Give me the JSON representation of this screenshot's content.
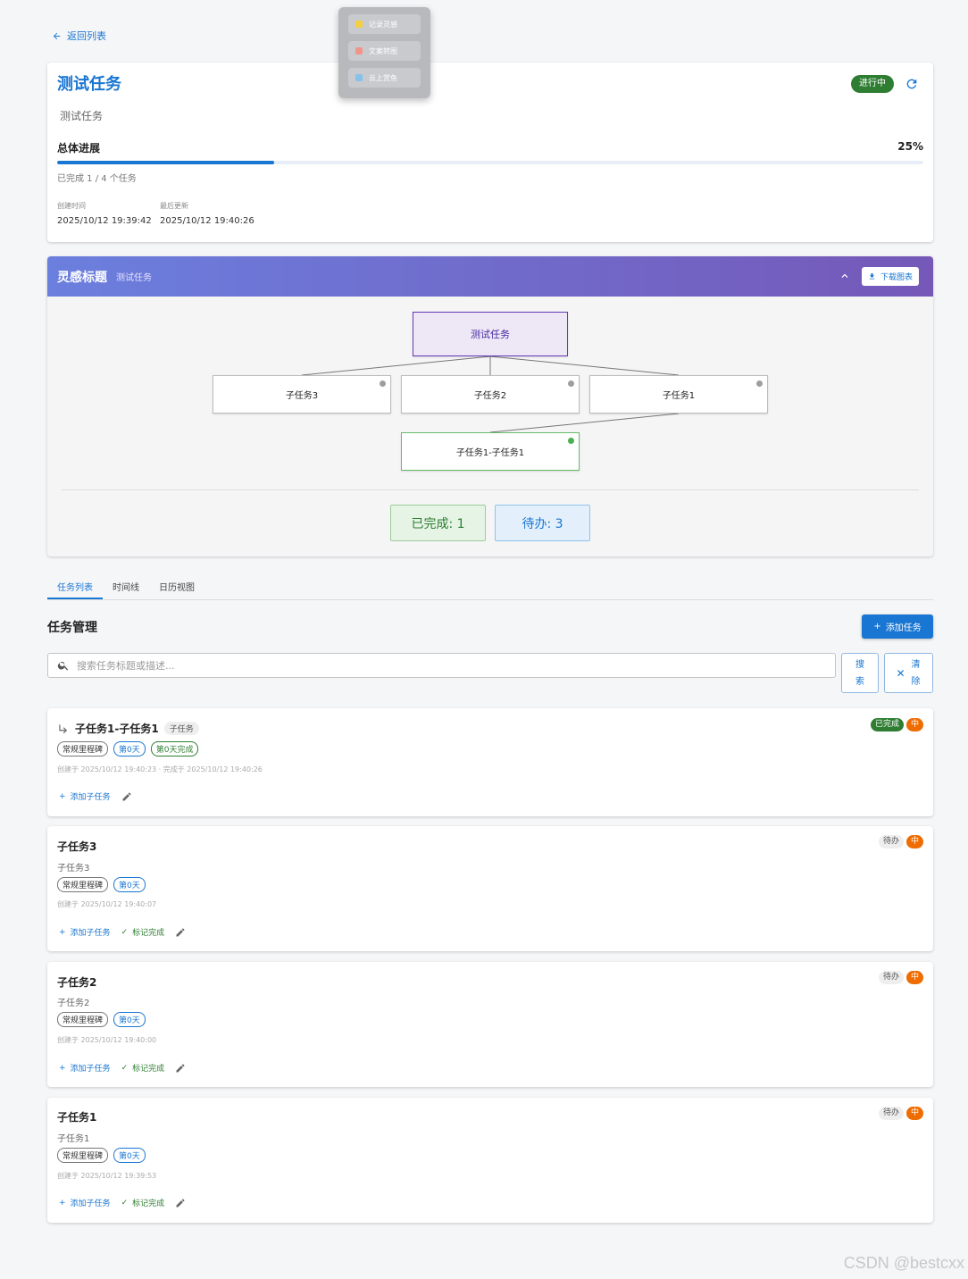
{
  "nav": {
    "back_label": "返回列表"
  },
  "quick_menu": {
    "items": [
      {
        "label": "记录灵感",
        "color": "#f4d03f"
      },
      {
        "label": "文案转图",
        "color": "#f1948a"
      },
      {
        "label": "云上赏鱼",
        "color": "#85c1e9"
      }
    ]
  },
  "task": {
    "title": "测试任务",
    "description": "测试任务",
    "status": "进行中",
    "progress_label": "总体进展",
    "progress_percent": "25%",
    "progress_value": 0.25,
    "progress_sub": "已完成 1 / 4 个任务",
    "created_label": "创建时间",
    "created_value": "2025/10/12 19:39:42",
    "updated_label": "最后更新",
    "updated_value": "2025/10/12 19:40:26"
  },
  "inspiration": {
    "title": "灵感标题",
    "subtitle": "测试任务",
    "download_label": "下载图表",
    "root": "测试任务",
    "nodes": [
      "子任务3",
      "子任务2",
      "子任务1"
    ],
    "child_node": "子任务1-子任务1",
    "stat_done": "已完成: 1",
    "stat_todo": "待办: 3"
  },
  "tabs": [
    "任务列表",
    "时间线",
    "日历视图"
  ],
  "manage": {
    "title": "任务管理",
    "add_label": "添加任务",
    "search_placeholder": "搜索任务标题或描述...",
    "search_label": "搜索",
    "clear_label": "清除"
  },
  "items": [
    {
      "title": "子任务1-子任务1",
      "sub_tag": "子任务",
      "tags": [
        "常规里程碑",
        "第0天",
        "第0天完成"
      ],
      "meta": "创建于 2025/10/12 19:40:23 · 完成于 2025/10/12 19:40:26",
      "status": "已完成",
      "priority": "中",
      "add_sub": "添加子任务"
    },
    {
      "title": "子任务3",
      "description": "子任务3",
      "tags": [
        "常规里程碑",
        "第0天"
      ],
      "meta": "创建于 2025/10/12 19:40:07",
      "status": "待办",
      "priority": "中",
      "add_sub": "添加子任务",
      "complete": "标记完成"
    },
    {
      "title": "子任务2",
      "description": "子任务2",
      "tags": [
        "常规里程碑",
        "第0天"
      ],
      "meta": "创建于 2025/10/12 19:40:00",
      "status": "待办",
      "priority": "中",
      "add_sub": "添加子任务",
      "complete": "标记完成"
    },
    {
      "title": "子任务1",
      "description": "子任务1",
      "tags": [
        "常规里程碑",
        "第0天"
      ],
      "meta": "创建于 2025/10/12 19:39:53",
      "status": "待办",
      "priority": "中",
      "add_sub": "添加子任务",
      "complete": "标记完成"
    }
  ],
  "watermark": "CSDN @bestcxx"
}
